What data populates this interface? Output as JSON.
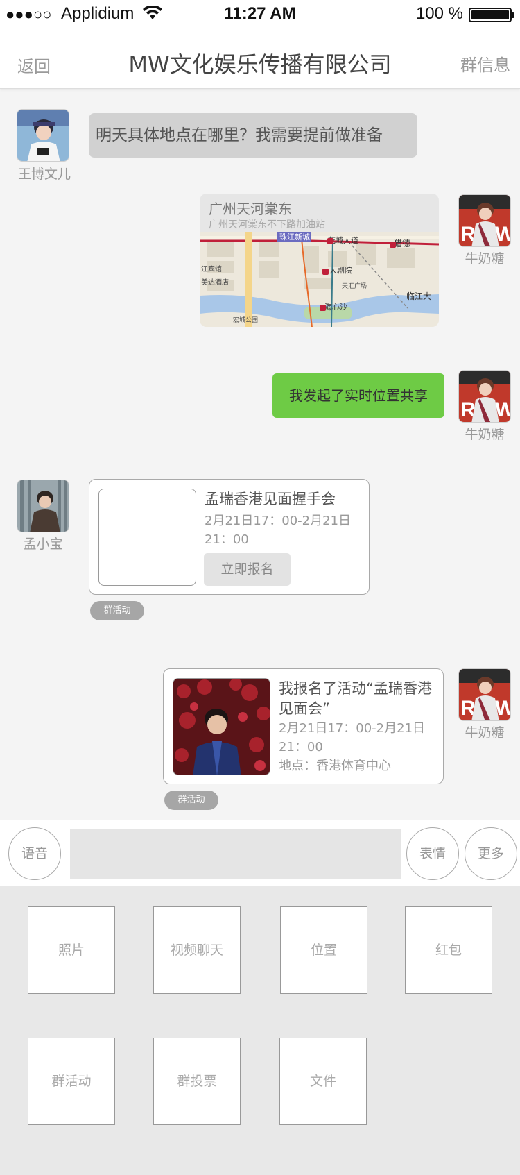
{
  "status_bar": {
    "signal": "●●●○○",
    "carrier": "Applidium",
    "time": "11:27 AM",
    "battery": "100 %"
  },
  "navbar": {
    "back": "返回",
    "title": "MW文化娱乐传播有限公司",
    "info": "群信息"
  },
  "messages": [
    {
      "sender": "王博文儿",
      "type": "text",
      "text": "明天具体地点在哪里？我需要提前做准备"
    },
    {
      "sender": "牛奶糖",
      "type": "location",
      "title": "广州天河棠东",
      "subtitle": "广州天河棠东不下路加油站",
      "map_labels": [
        "珠江新城",
        "花城大道",
        "猎德",
        "江宾馆",
        "美达酒店",
        "大剧院",
        "天汇广场",
        "临江大",
        "海心沙",
        "宏城公园"
      ]
    },
    {
      "sender": "牛奶糖",
      "type": "text",
      "text": "我发起了实时位置共享"
    },
    {
      "sender": "孟小宝",
      "type": "event",
      "title": "孟瑞香港见面握手会",
      "time": "2月21日17：00-2月21日21：00",
      "button": "立即报名",
      "tag": "群活动"
    },
    {
      "sender": "牛奶糖",
      "type": "event",
      "title": "我报名了活动“孟瑞香港见面会”",
      "time": "2月21日17：00-2月21日21：00",
      "location": "地点：香港体育中心",
      "tag": "群活动"
    }
  ],
  "input_bar": {
    "voice": "语音",
    "emoji": "表情",
    "more": "更多"
  },
  "panel": {
    "items": [
      "照片",
      "视频聊天",
      "位置",
      "红包",
      "群活动",
      "群投票",
      "文件"
    ]
  }
}
